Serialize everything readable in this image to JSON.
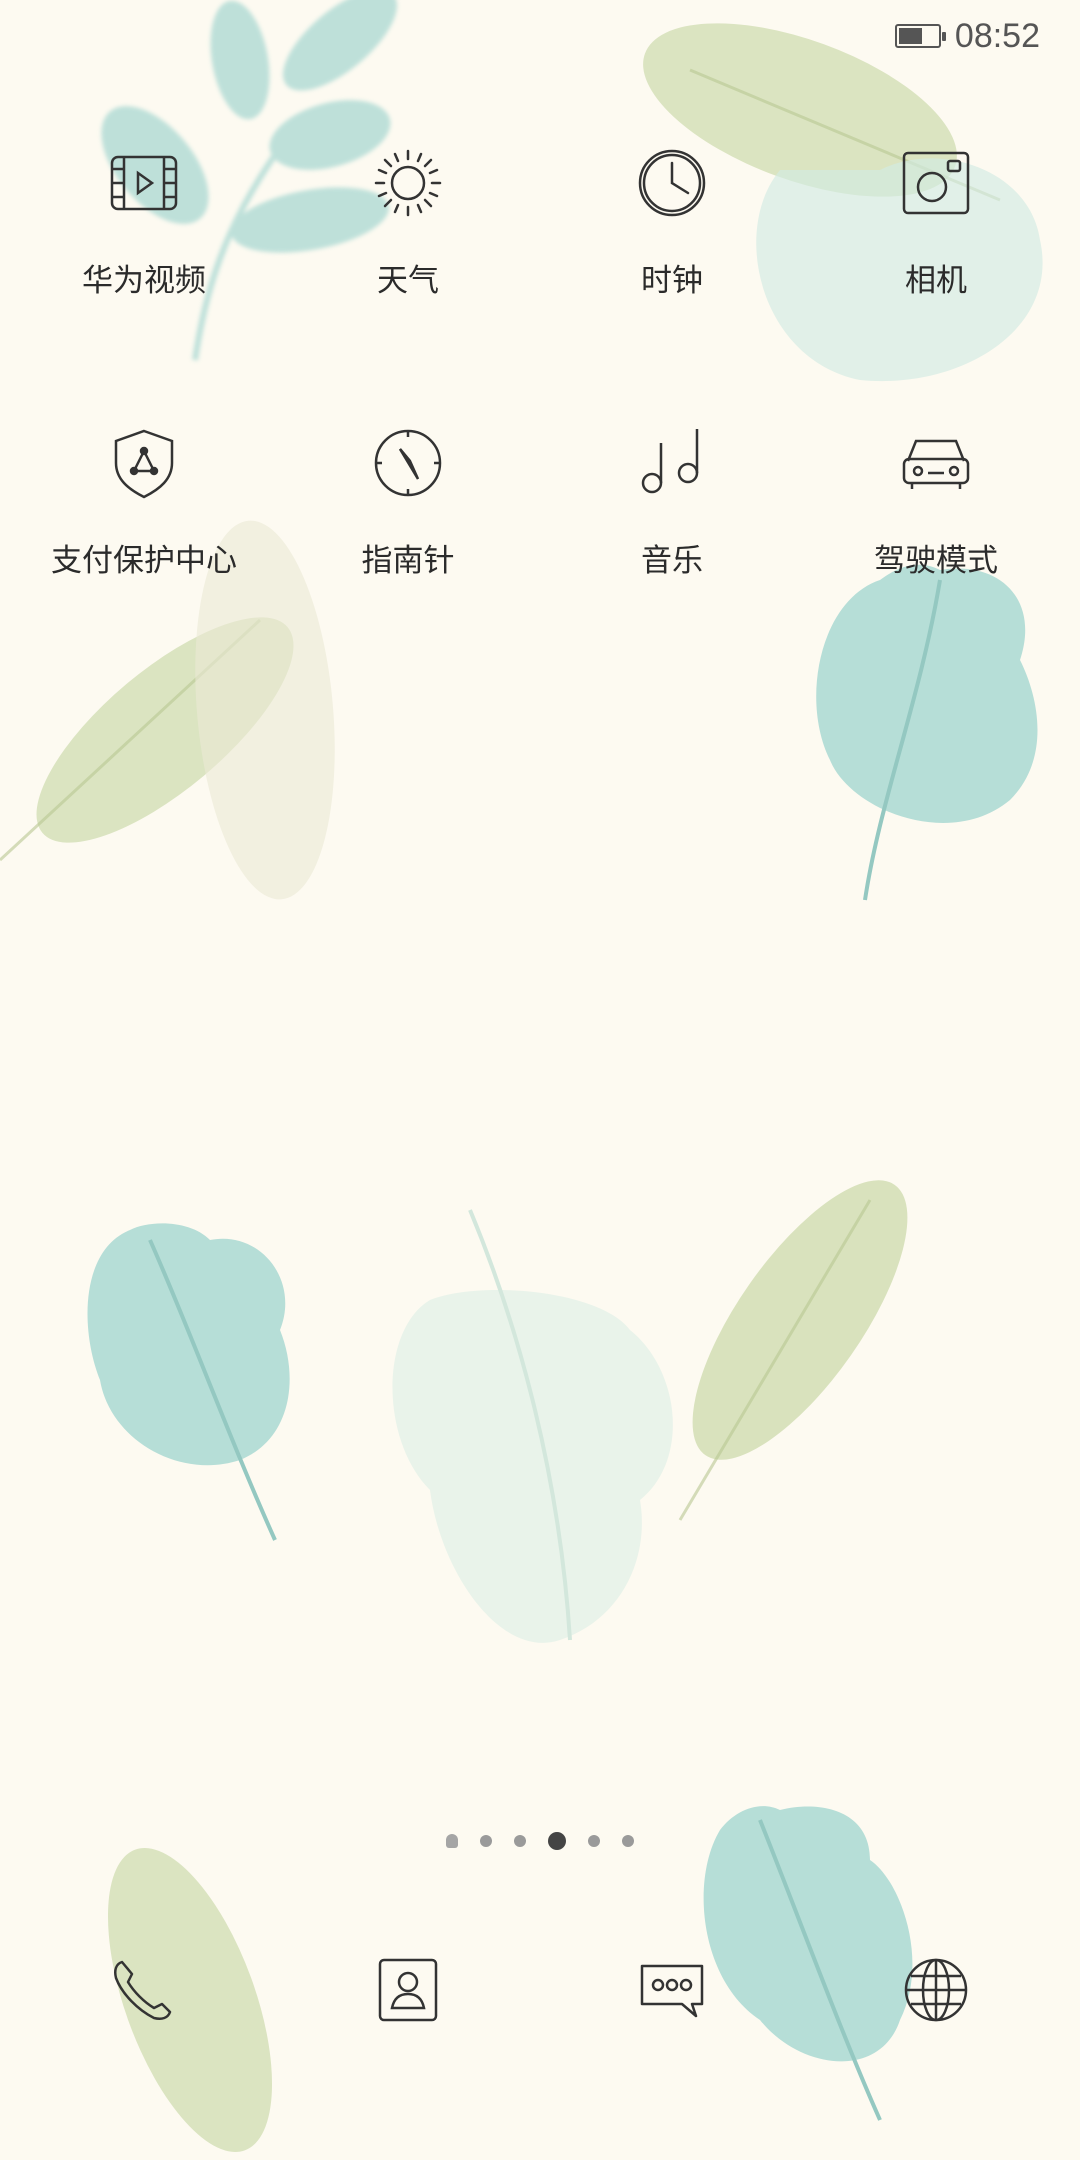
{
  "status_bar": {
    "time": "08:52",
    "battery_level": 0.6,
    "battery_icon": "battery-icon"
  },
  "apps": [
    {
      "label": "华为视频",
      "icon": "video-icon"
    },
    {
      "label": "天气",
      "icon": "sun-icon"
    },
    {
      "label": "时钟",
      "icon": "clock-icon"
    },
    {
      "label": "相机",
      "icon": "camera-icon"
    },
    {
      "label": "支付保护中心",
      "icon": "shield-icon"
    },
    {
      "label": "指南针",
      "icon": "compass-icon"
    },
    {
      "label": "音乐",
      "icon": "music-note-icon"
    },
    {
      "label": "驾驶模式",
      "icon": "car-icon"
    }
  ],
  "page_indicator": {
    "total": 6,
    "active_index": 3
  },
  "dock": [
    {
      "icon": "phone-icon"
    },
    {
      "icon": "contacts-icon"
    },
    {
      "icon": "messages-icon"
    },
    {
      "icon": "globe-icon"
    }
  ],
  "colors": {
    "background": "#fdfaf1",
    "leaf_teal": "#a9d8d2",
    "leaf_green": "#cfdcb0",
    "icon_stroke": "#333333"
  }
}
